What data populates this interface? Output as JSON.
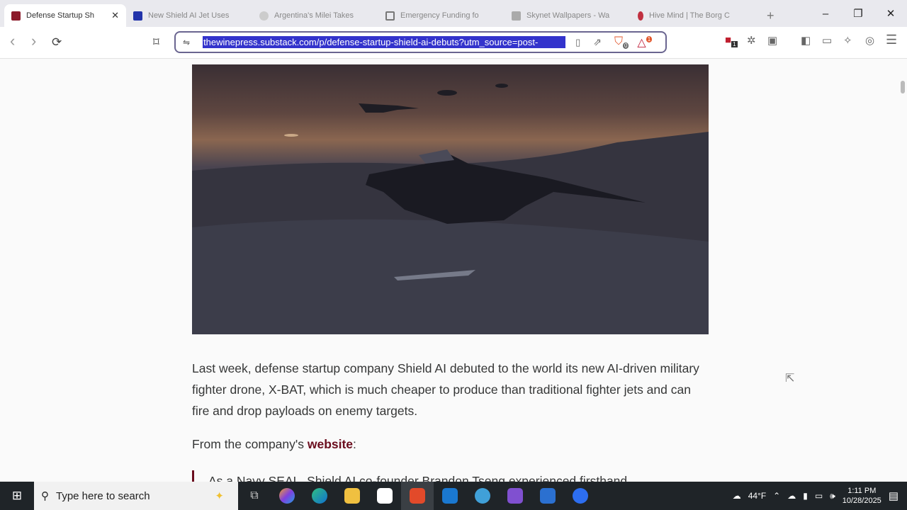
{
  "tabs": [
    {
      "title": "Defense Startup Sh",
      "color": "#8b1a2a",
      "active": true
    },
    {
      "title": "New Shield AI Jet Uses",
      "color": "#2233aa"
    },
    {
      "title": "Argentina's Milei Takes",
      "color": "#999"
    },
    {
      "title": "Emergency Funding fo",
      "color": "#777"
    },
    {
      "title": "Skynet Wallpapers - Wa",
      "color": "#888"
    },
    {
      "title": "Hive Mind | The Borg C",
      "color": "#c03040"
    }
  ],
  "window": {
    "new_tab": "+",
    "minimize": "–",
    "restore": "❐",
    "close": "✕"
  },
  "toolbar": {
    "back": "‹",
    "forward": "›",
    "reload": "⟳",
    "bookmark": "⌑",
    "url": "thewinepress.substack.com/p/defense-startup-shield-ai-debuts?utm_source=post-",
    "shields_badge": "0",
    "rewards_badge": "1",
    "ext_badge": "1"
  },
  "article": {
    "paragraph": "Last week, defense startup company Shield AI debuted to the world its new AI-driven military fighter drone, X-BAT, which is much cheaper to produce than traditional fighter jets and can fire and drop payloads on enemy targets.",
    "from_prefix": "From the company's ",
    "from_link": "website",
    "from_suffix": ":",
    "quote": "As a Navy SEAL, Shield AI co-founder Brandon Tseng experienced firsthand"
  },
  "taskbar": {
    "search_placeholder": "Type here to search",
    "weather": "44°F",
    "time": "1:11 PM",
    "date": "10/28/2025"
  }
}
